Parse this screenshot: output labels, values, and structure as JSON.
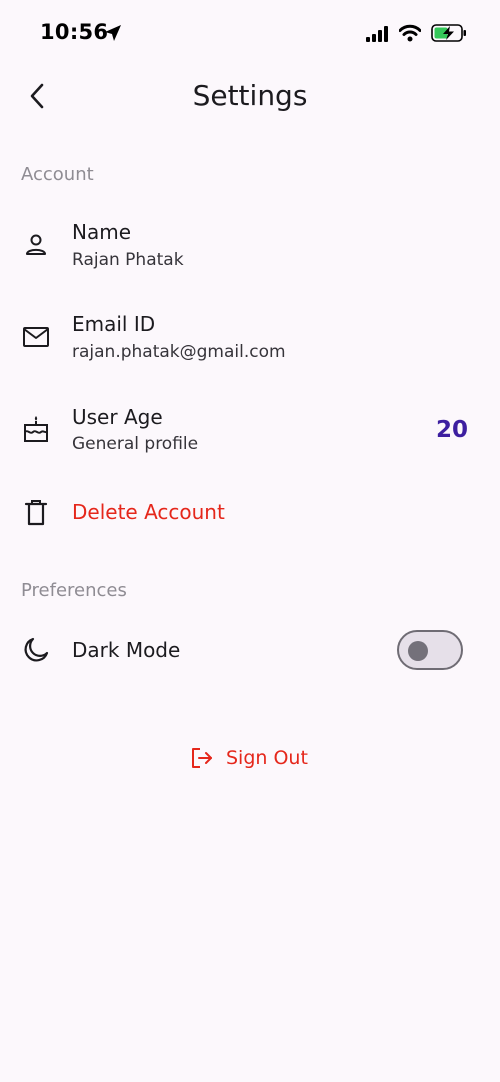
{
  "status_bar": {
    "time": "10:56",
    "location_icon": "location-arrow-icon",
    "signal_icon": "cellular-signal-icon",
    "wifi_icon": "wifi-icon",
    "battery_icon": "battery-charging-icon"
  },
  "header": {
    "title": "Settings",
    "back_icon": "chevron-left-icon"
  },
  "sections": {
    "account": {
      "title": "Account",
      "name": {
        "icon": "person-icon",
        "title": "Name",
        "subtitle": "Rajan Phatak"
      },
      "email": {
        "icon": "mail-icon",
        "title": "Email ID",
        "subtitle": "rajan.phatak@gmail.com"
      },
      "age": {
        "icon": "cake-icon",
        "title": "User Age",
        "subtitle": "General profile",
        "value": "20"
      },
      "delete": {
        "icon": "trash-icon",
        "label": "Delete Account"
      }
    },
    "preferences": {
      "title": "Preferences",
      "dark_mode": {
        "icon": "moon-icon",
        "label": "Dark Mode",
        "enabled": false
      }
    }
  },
  "sign_out": {
    "icon": "logout-icon",
    "label": "Sign Out"
  },
  "colors": {
    "background": "#fcf8fc",
    "accent_value": "#3d1fa0",
    "danger": "#e5271b",
    "section_header": "#8f8c93"
  }
}
